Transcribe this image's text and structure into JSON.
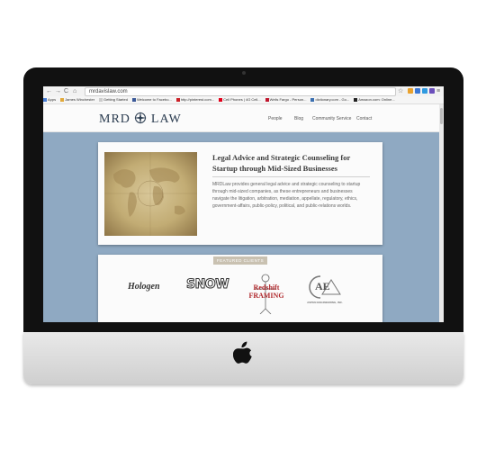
{
  "browser": {
    "url": "mrdavislaw.com",
    "nav_back": "←",
    "nav_forward": "→",
    "nav_reload": "C",
    "nav_home": "⌂",
    "star": "☆",
    "menu": "≡",
    "bookmarks": [
      {
        "label": "Apps",
        "color": "#4a7fd6"
      },
      {
        "label": "James Winchester",
        "color": "#e1a93a"
      },
      {
        "label": "Getting Started",
        "color": "#cccccc"
      },
      {
        "label": "Welcome to Facebo...",
        "color": "#3b5998"
      },
      {
        "label": "http://pinterest.com...",
        "color": "#cb2027"
      },
      {
        "label": "Cell Phones | 4G Cell...",
        "color": "#e2001a"
      },
      {
        "label": "Wells Fargo - Person...",
        "color": "#c0162d"
      },
      {
        "label": "dictionary.com - Go...",
        "color": "#3a6fb0"
      },
      {
        "label": "Amazon.com: Online...",
        "color": "#222222"
      }
    ]
  },
  "site": {
    "logo_left": "MRD",
    "logo_right": "LAW",
    "nav": [
      "People",
      "Blog",
      "Community Service",
      "Contact"
    ]
  },
  "intro": {
    "heading": "Legal Advice and Strategic Counseling for Startup through Mid-Sized Businesses",
    "body": "MRDLaw provides general legal advice and strategic counseling to startup through mid-sized companies, as these entrepreneurs and businesses navigate the litigation, arbitration, mediation, appellate, regulatory, ethics, government-affairs, public-policy, political, and public-relations worlds."
  },
  "clients": {
    "label": "FEATURED CLIENTS",
    "logos": [
      "Hologen",
      "SNOW",
      "Redshift FRAMING",
      "AE"
    ],
    "ae_sub": "ASPEN ENGINEERING, INC."
  },
  "colors": {
    "page_bg": "#8fa9c2",
    "logo": "#2a3b4f",
    "featured_label_bg": "#c9c1b1"
  }
}
